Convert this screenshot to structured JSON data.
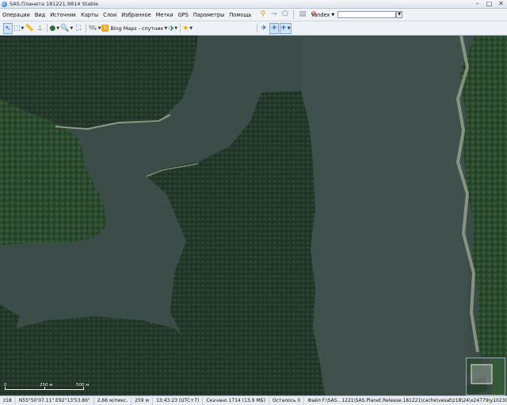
{
  "window": {
    "title": "SAS.Планета 181221.9814 Stable"
  },
  "menu": {
    "items": [
      "Операции",
      "Вид",
      "Источник",
      "Карты",
      "Слои",
      "Избранное",
      "Метки",
      "GPS",
      "Параметры",
      "Помощь"
    ]
  },
  "search": {
    "provider": "Yandex"
  },
  "toolbar": {
    "map_source": "Bing Maps - спутник"
  },
  "scale": {
    "mid_label": "250 м",
    "end_label": "500 м",
    "start_label": "0"
  },
  "status": {
    "zoom": "z18",
    "coords": "N55°50'07.11\" E92°13'53.86\"",
    "resolution": "2,66 м/пикс.",
    "altitude": "259 м",
    "time": "13:43:23 (UTC+7)",
    "downloaded": "Скачано 1714 (13,9 МБ)",
    "remaining": "Осталось 0",
    "file": "Файл F:\\SAS...1221\\SAS.Planet.Release.181221\\cache\\vesat\\z18\\24\\x24779\\y10230.jpg"
  },
  "colors": {
    "water": "#3c4c49",
    "forest": "#24382a",
    "shore": "#b9c2a6"
  }
}
